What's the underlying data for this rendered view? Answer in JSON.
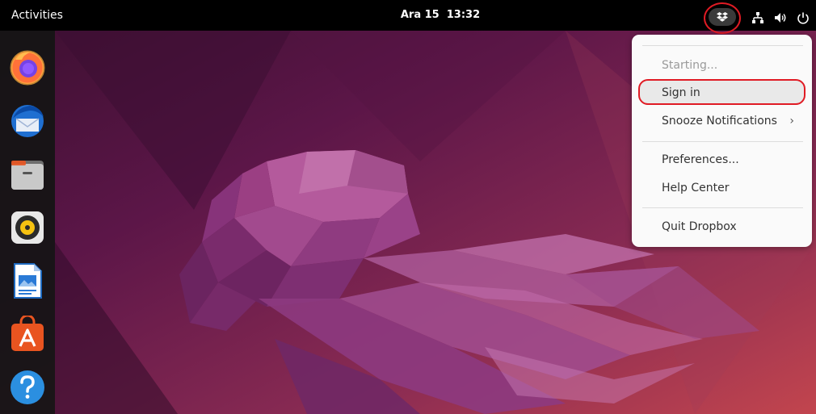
{
  "topbar": {
    "activities_label": "Activities",
    "date": "Ara 15",
    "time": "13:32"
  },
  "tray": {
    "icons": [
      "dropbox-icon",
      "network-icon",
      "volume-icon",
      "power-icon"
    ]
  },
  "dock": {
    "apps": [
      "firefox",
      "thunderbird",
      "files",
      "rhythmbox",
      "libreoffice-writer",
      "ubuntu-software",
      "help"
    ]
  },
  "menu": {
    "status": "Starting...",
    "sign_in": "Sign in",
    "snooze": "Snooze Notifications",
    "snooze_arrow": "›",
    "preferences": "Preferences...",
    "help_center": "Help Center",
    "quit": "Quit Dropbox"
  },
  "colors": {
    "highlight": "#e01b24",
    "wallpaper_dark": "#2c0f24",
    "wallpaper_mid": "#77216f"
  }
}
